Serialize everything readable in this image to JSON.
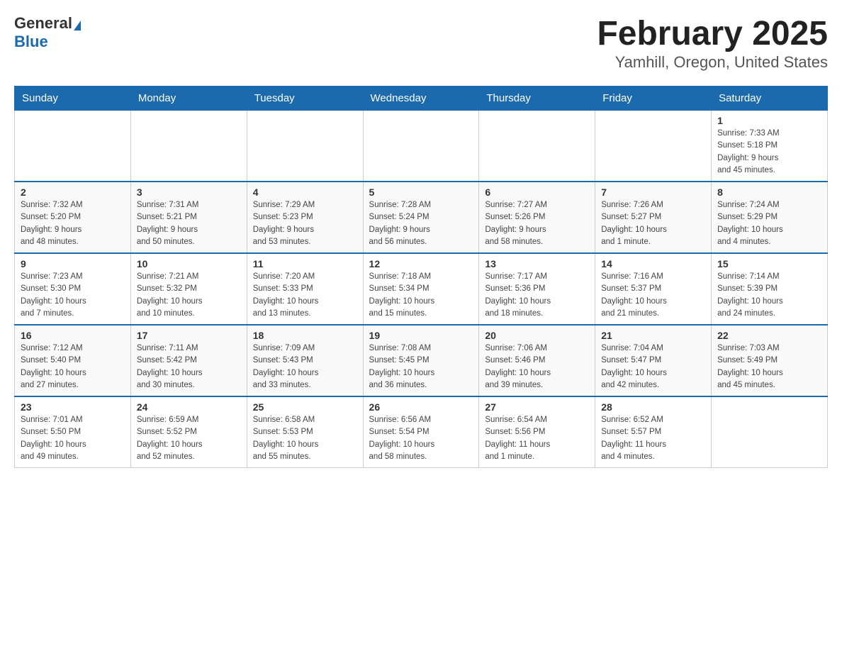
{
  "header": {
    "logo_general": "General",
    "logo_blue": "Blue",
    "title": "February 2025",
    "subtitle": "Yamhill, Oregon, United States"
  },
  "days_of_week": [
    "Sunday",
    "Monday",
    "Tuesday",
    "Wednesday",
    "Thursday",
    "Friday",
    "Saturday"
  ],
  "weeks": [
    [
      {
        "day": "",
        "info": ""
      },
      {
        "day": "",
        "info": ""
      },
      {
        "day": "",
        "info": ""
      },
      {
        "day": "",
        "info": ""
      },
      {
        "day": "",
        "info": ""
      },
      {
        "day": "",
        "info": ""
      },
      {
        "day": "1",
        "info": "Sunrise: 7:33 AM\nSunset: 5:18 PM\nDaylight: 9 hours\nand 45 minutes."
      }
    ],
    [
      {
        "day": "2",
        "info": "Sunrise: 7:32 AM\nSunset: 5:20 PM\nDaylight: 9 hours\nand 48 minutes."
      },
      {
        "day": "3",
        "info": "Sunrise: 7:31 AM\nSunset: 5:21 PM\nDaylight: 9 hours\nand 50 minutes."
      },
      {
        "day": "4",
        "info": "Sunrise: 7:29 AM\nSunset: 5:23 PM\nDaylight: 9 hours\nand 53 minutes."
      },
      {
        "day": "5",
        "info": "Sunrise: 7:28 AM\nSunset: 5:24 PM\nDaylight: 9 hours\nand 56 minutes."
      },
      {
        "day": "6",
        "info": "Sunrise: 7:27 AM\nSunset: 5:26 PM\nDaylight: 9 hours\nand 58 minutes."
      },
      {
        "day": "7",
        "info": "Sunrise: 7:26 AM\nSunset: 5:27 PM\nDaylight: 10 hours\nand 1 minute."
      },
      {
        "day": "8",
        "info": "Sunrise: 7:24 AM\nSunset: 5:29 PM\nDaylight: 10 hours\nand 4 minutes."
      }
    ],
    [
      {
        "day": "9",
        "info": "Sunrise: 7:23 AM\nSunset: 5:30 PM\nDaylight: 10 hours\nand 7 minutes."
      },
      {
        "day": "10",
        "info": "Sunrise: 7:21 AM\nSunset: 5:32 PM\nDaylight: 10 hours\nand 10 minutes."
      },
      {
        "day": "11",
        "info": "Sunrise: 7:20 AM\nSunset: 5:33 PM\nDaylight: 10 hours\nand 13 minutes."
      },
      {
        "day": "12",
        "info": "Sunrise: 7:18 AM\nSunset: 5:34 PM\nDaylight: 10 hours\nand 15 minutes."
      },
      {
        "day": "13",
        "info": "Sunrise: 7:17 AM\nSunset: 5:36 PM\nDaylight: 10 hours\nand 18 minutes."
      },
      {
        "day": "14",
        "info": "Sunrise: 7:16 AM\nSunset: 5:37 PM\nDaylight: 10 hours\nand 21 minutes."
      },
      {
        "day": "15",
        "info": "Sunrise: 7:14 AM\nSunset: 5:39 PM\nDaylight: 10 hours\nand 24 minutes."
      }
    ],
    [
      {
        "day": "16",
        "info": "Sunrise: 7:12 AM\nSunset: 5:40 PM\nDaylight: 10 hours\nand 27 minutes."
      },
      {
        "day": "17",
        "info": "Sunrise: 7:11 AM\nSunset: 5:42 PM\nDaylight: 10 hours\nand 30 minutes."
      },
      {
        "day": "18",
        "info": "Sunrise: 7:09 AM\nSunset: 5:43 PM\nDaylight: 10 hours\nand 33 minutes."
      },
      {
        "day": "19",
        "info": "Sunrise: 7:08 AM\nSunset: 5:45 PM\nDaylight: 10 hours\nand 36 minutes."
      },
      {
        "day": "20",
        "info": "Sunrise: 7:06 AM\nSunset: 5:46 PM\nDaylight: 10 hours\nand 39 minutes."
      },
      {
        "day": "21",
        "info": "Sunrise: 7:04 AM\nSunset: 5:47 PM\nDaylight: 10 hours\nand 42 minutes."
      },
      {
        "day": "22",
        "info": "Sunrise: 7:03 AM\nSunset: 5:49 PM\nDaylight: 10 hours\nand 45 minutes."
      }
    ],
    [
      {
        "day": "23",
        "info": "Sunrise: 7:01 AM\nSunset: 5:50 PM\nDaylight: 10 hours\nand 49 minutes."
      },
      {
        "day": "24",
        "info": "Sunrise: 6:59 AM\nSunset: 5:52 PM\nDaylight: 10 hours\nand 52 minutes."
      },
      {
        "day": "25",
        "info": "Sunrise: 6:58 AM\nSunset: 5:53 PM\nDaylight: 10 hours\nand 55 minutes."
      },
      {
        "day": "26",
        "info": "Sunrise: 6:56 AM\nSunset: 5:54 PM\nDaylight: 10 hours\nand 58 minutes."
      },
      {
        "day": "27",
        "info": "Sunrise: 6:54 AM\nSunset: 5:56 PM\nDaylight: 11 hours\nand 1 minute."
      },
      {
        "day": "28",
        "info": "Sunrise: 6:52 AM\nSunset: 5:57 PM\nDaylight: 11 hours\nand 4 minutes."
      },
      {
        "day": "",
        "info": ""
      }
    ]
  ]
}
